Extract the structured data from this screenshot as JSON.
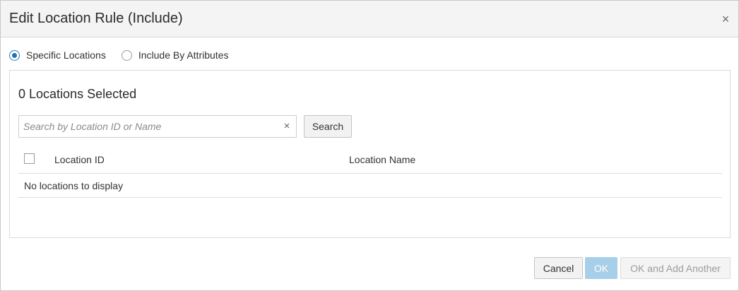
{
  "dialog": {
    "title": "Edit Location Rule (Include)",
    "close_glyph": "×"
  },
  "mode": {
    "options": [
      {
        "label": "Specific Locations",
        "selected": true
      },
      {
        "label": "Include By Attributes",
        "selected": false
      }
    ]
  },
  "panel": {
    "title": "0 Locations Selected",
    "search": {
      "placeholder": "Search by Location ID or Name",
      "value": "",
      "clear_glyph": "×",
      "button_label": "Search"
    },
    "table": {
      "columns": [
        "Location ID",
        "Location Name"
      ],
      "select_all_checked": false,
      "rows": [],
      "empty_message": "No locations to display"
    }
  },
  "footer": {
    "cancel_label": "Cancel",
    "ok_label": "OK",
    "ok_add_label": "OK and Add Another"
  },
  "colors": {
    "accent": "#1f72b5",
    "ok_disabled": "#a8cfe9",
    "header_bg": "#f4f4f4"
  }
}
